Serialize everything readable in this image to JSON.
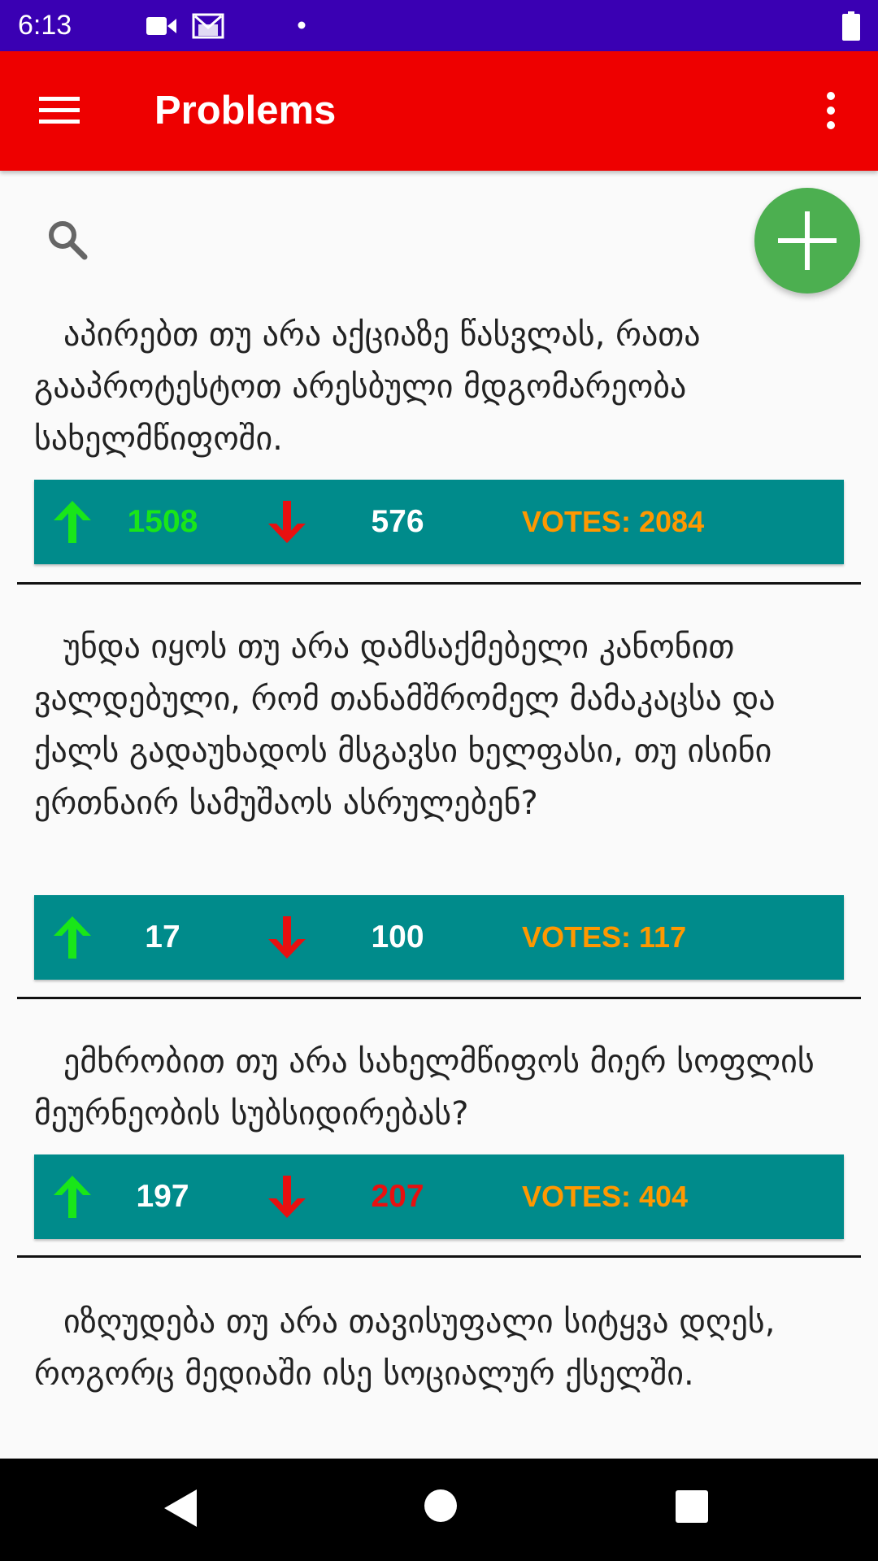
{
  "status_bar": {
    "time": "6:13",
    "icons": [
      "video-camera-icon",
      "gmail-icon",
      "notification-dot-icon",
      "battery-icon"
    ],
    "background": "#3a00b3"
  },
  "app_bar": {
    "title": "Problems",
    "background": "#ee0000",
    "left_icon": "menu-icon",
    "right_icon": "overflow-menu-icon"
  },
  "search": {
    "icon": "search-icon"
  },
  "fab": {
    "icon": "plus-icon",
    "color": "#4caf50"
  },
  "problems": [
    {
      "text": "აპირებთ თუ არა აქციაზე წასვლას, რათა გააპროტესტოთ არესბული მდგომარეობა სახელმწიფოში.",
      "up": "1508",
      "down": "576",
      "total": "VOTES: 2084",
      "up_color": "#19e619",
      "down_color": "#ffffff"
    },
    {
      "text": "უნდა იყოს თუ არა დამსაქმებელი კანონით ვალდებული, რომ თანამშრომელ მამაკაცსა და ქალს გადაუხადოს მსგავსი ხელფასი, თუ ისინი ერთნაირ სამუშაოს ასრულებენ?",
      "up": "17",
      "down": "100",
      "total": "VOTES: 117",
      "up_color": "#ffffff",
      "down_color": "#ffffff"
    },
    {
      "text": "ემხრობით თუ არა სახელმწიფოს მიერ სოფლის მეურნეობის სუბსიდირებას?",
      "up": "197",
      "down": "207",
      "total": "VOTES: 404",
      "up_color": "#ffffff",
      "down_color": "#e81010"
    },
    {
      "text": "იზღუდება თუ არა თავისუფალი სიტყვა დღეს, როგორც მედიაში ისე სოციალურ ქსელში."
    }
  ],
  "colors": {
    "vote_bar": "#008b8b",
    "up_arrow": "#19e619",
    "down_arrow": "#e81010",
    "votes_total": "#ff9800"
  },
  "nav_bar": {
    "icons": [
      "back-icon",
      "home-icon",
      "recents-icon"
    ]
  }
}
